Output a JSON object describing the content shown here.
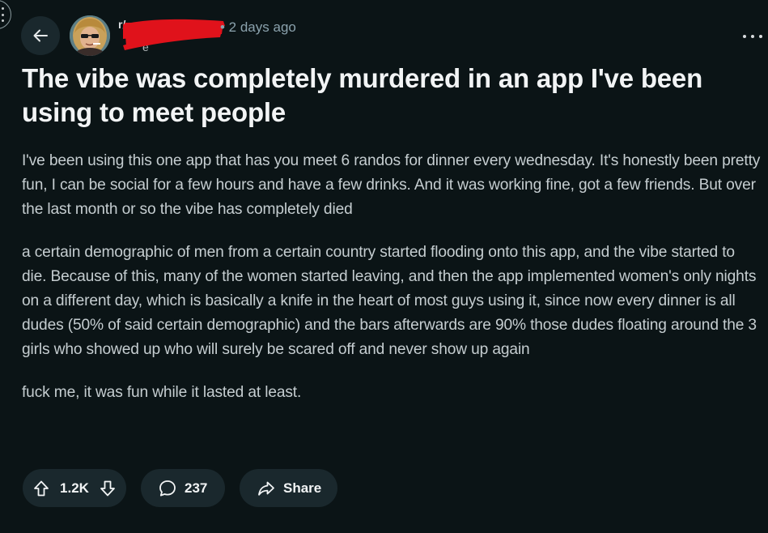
{
  "header": {
    "author_name": "r/",
    "author_subline": "e",
    "timestamp": "• 2 days ago"
  },
  "post": {
    "title": "The vibe was completely murdered in an app I've been using to meet people",
    "paragraphs": [
      "I've been using this one app that has you meet 6 randos for dinner every wednesday. It's honestly been pretty fun, I can be social for a few hours and have a few drinks. And it was working fine, got a few friends. But over the last month or so the vibe has completely died",
      "a certain demographic of men from a certain country started flooding onto this app, and the vibe started to die. Because of this, many of the women started leaving, and then the app implemented women's only nights on a different day, which is basically a knife in the heart of most guys using it, since now every dinner is all dudes (50% of said certain demographic) and the bars afterwards are 90% those dudes floating around the 3 girls who showed up who will surely be scared off and never show up again",
      "fuck me, it was fun while it lasted at least."
    ]
  },
  "actions": {
    "vote_count": "1.2K",
    "comment_count": "237",
    "share_label": "Share"
  },
  "icons": {
    "back": "arrow-left-icon",
    "more": "more-horizontal-icon",
    "upvote": "arrow-up-icon",
    "downvote": "arrow-down-icon",
    "comment": "speech-bubble-icon",
    "share": "share-arrow-icon"
  },
  "colors": {
    "background": "#0b1416",
    "pill": "#1a282d",
    "redaction": "#e0121b",
    "timestamp": "#8ba2ad"
  }
}
